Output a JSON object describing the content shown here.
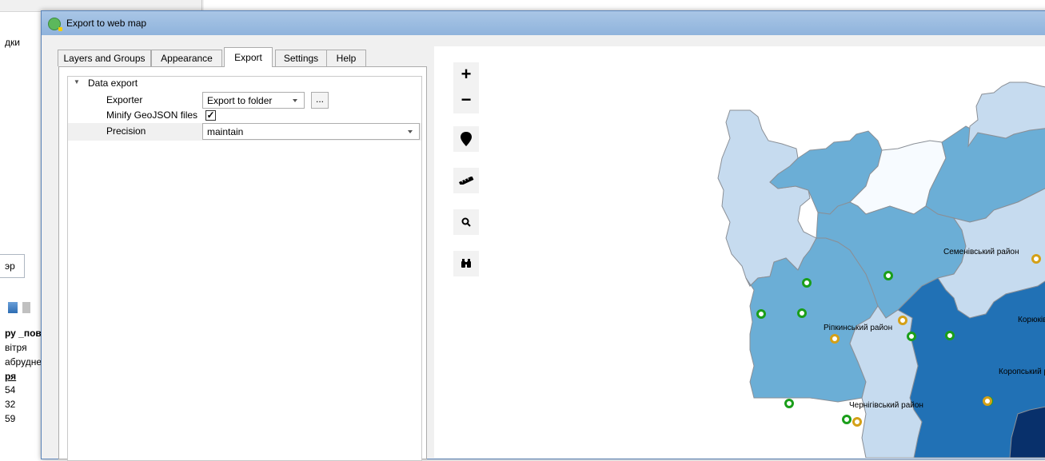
{
  "background_app": {
    "side_text_top": "дки",
    "tab_label": "эр",
    "fields": [
      "ру _пові",
      "вітря",
      "абрудне",
      "ря",
      "54",
      "32",
      "59"
    ]
  },
  "dialog": {
    "title": "Export to web map",
    "tabs": [
      {
        "label": "Layers and Groups",
        "active": false
      },
      {
        "label": "Appearance",
        "active": false
      },
      {
        "label": "Export",
        "active": true
      },
      {
        "label": "Settings",
        "active": false
      },
      {
        "label": "Help",
        "active": false
      }
    ],
    "export": {
      "group_label": "Data export",
      "exporter_label": "Exporter",
      "exporter_value": "Export to folder",
      "browse_button": "...",
      "minify_label": "Minify GeoJSON files",
      "minify_checked": "✓",
      "precision_label": "Precision",
      "precision_value": "maintain"
    }
  },
  "map": {
    "controls": {
      "zoom_in": "+",
      "zoom_out": "−",
      "icons": [
        "location-marker-icon",
        "ruler-icon",
        "search-icon",
        "binoculars-icon"
      ]
    },
    "labels": {
      "semenivskyi": "Семенівський район",
      "ripkynskyi": "Ріпкинський район",
      "koriukivskyi": "Корюківськ",
      "koropskyi": "Коропський район",
      "chernihivskyi": "Чернігівський район"
    },
    "colors": {
      "darkest": "#08306b",
      "dark": "#2171b5",
      "medium": "#6baed6",
      "light": "#c6dbef",
      "lightest": "#f7fbff",
      "marker_green": "#1a9e1a",
      "marker_gold": "#d4a017"
    }
  }
}
